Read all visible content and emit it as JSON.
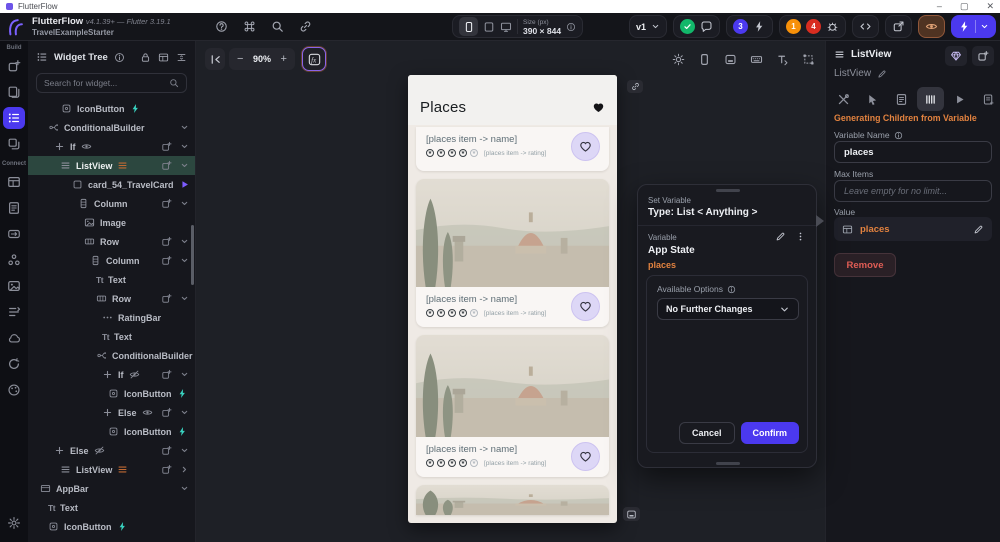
{
  "window": {
    "title": "FlutterFlow",
    "minimize": "–",
    "maximize": "▢",
    "close": "✕"
  },
  "header": {
    "brand": "FlutterFlow",
    "version": "v4.1.39+ — Flutter 3.19.1",
    "project": "TravelExampleStarter",
    "size_label": "Size (px)",
    "size_value": "390 × 844",
    "version_tag": "v1",
    "run_badge": "3",
    "warn_badge": "1",
    "error_badge": "4"
  },
  "rail": {
    "build_label": "Build",
    "connect_label": "Connect"
  },
  "tree_panel": {
    "title": "Widget Tree",
    "search_placeholder": "Search for widget...",
    "items": [
      {
        "label": "IconButton",
        "icon": "iconbutton",
        "indent": 33,
        "action": true
      },
      {
        "label": "ConditionalBuilder",
        "icon": "cond",
        "indent": 20,
        "caret": "down"
      },
      {
        "label": "If",
        "icon": "plus",
        "indent": 26,
        "eye": "on",
        "add": true,
        "caret": "down"
      },
      {
        "label": "ListView",
        "icon": "listview",
        "indent": 32,
        "badge": true,
        "add": true,
        "caret": "down",
        "selected": true
      },
      {
        "label": "card_54_TravelCard",
        "icon": "container",
        "indent": 44,
        "play": true,
        "add": true,
        "caret": "down"
      },
      {
        "label": "Column",
        "icon": "column",
        "indent": 50,
        "add": true,
        "caret": "down"
      },
      {
        "label": "Image",
        "icon": "image",
        "indent": 56
      },
      {
        "label": "Row",
        "icon": "row",
        "indent": 56,
        "add": true,
        "caret": "down"
      },
      {
        "label": "Column",
        "icon": "column",
        "indent": 62,
        "add": true,
        "caret": "down"
      },
      {
        "label": "Text",
        "icon": "text",
        "indent": 68
      },
      {
        "label": "Row",
        "icon": "row",
        "indent": 68,
        "add": true,
        "caret": "down"
      },
      {
        "label": "RatingBar",
        "icon": "rating",
        "indent": 74
      },
      {
        "label": "Text",
        "icon": "text",
        "indent": 74
      },
      {
        "label": "ConditionalBuilder",
        "icon": "cond",
        "indent": 68,
        "caret": "down"
      },
      {
        "label": "If",
        "icon": "plus",
        "indent": 74,
        "eye": "off",
        "add": true,
        "caret": "down"
      },
      {
        "label": "IconButton",
        "icon": "iconbutton",
        "indent": 80,
        "action": true
      },
      {
        "label": "Else",
        "icon": "plus",
        "indent": 74,
        "eye": "on",
        "add": true,
        "caret": "down"
      },
      {
        "label": "IconButton",
        "icon": "iconbutton",
        "indent": 80,
        "action": true
      },
      {
        "label": "Else",
        "icon": "plus",
        "indent": 26,
        "eye": "off",
        "add": true,
        "caret": "down"
      },
      {
        "label": "ListView",
        "icon": "listview",
        "indent": 32,
        "badge": true,
        "add": true,
        "caret": "right"
      },
      {
        "label": "AppBar",
        "icon": "appbar",
        "indent": 12,
        "caret": "down"
      },
      {
        "label": "Text",
        "icon": "text",
        "indent": 20
      },
      {
        "label": "IconButton",
        "icon": "iconbutton",
        "indent": 20,
        "action": true
      }
    ]
  },
  "canvas": {
    "zoom_level": "90%",
    "zoom_out": "−",
    "zoom_in": "+"
  },
  "phone": {
    "title": "Places",
    "cards": [
      {
        "name": "[places item -> name]",
        "rating": "[places item -> rating]"
      },
      {
        "name": "[places item -> name]",
        "rating": "[places item -> rating]"
      },
      {
        "name": "[places item -> name]",
        "rating": "[places item -> rating]"
      }
    ]
  },
  "popup": {
    "title": "Set Variable",
    "type_line": "Type: List < Anything >",
    "variable_label": "Variable",
    "variable_source": "App State",
    "variable_value": "places",
    "options_label": "Available Options",
    "dropdown_value": "No Further Changes",
    "cancel_label": "Cancel",
    "confirm_label": "Confirm"
  },
  "inspector": {
    "widget_type": "ListView",
    "widget_name": "ListView",
    "section_title": "Generating Children from Variable",
    "variable_name_label": "Variable Name",
    "variable_name_value": "places",
    "max_items_label": "Max Items",
    "max_items_placeholder": "Leave empty for no limit...",
    "value_label": "Value",
    "value_text": "places",
    "remove_label": "Remove"
  }
}
